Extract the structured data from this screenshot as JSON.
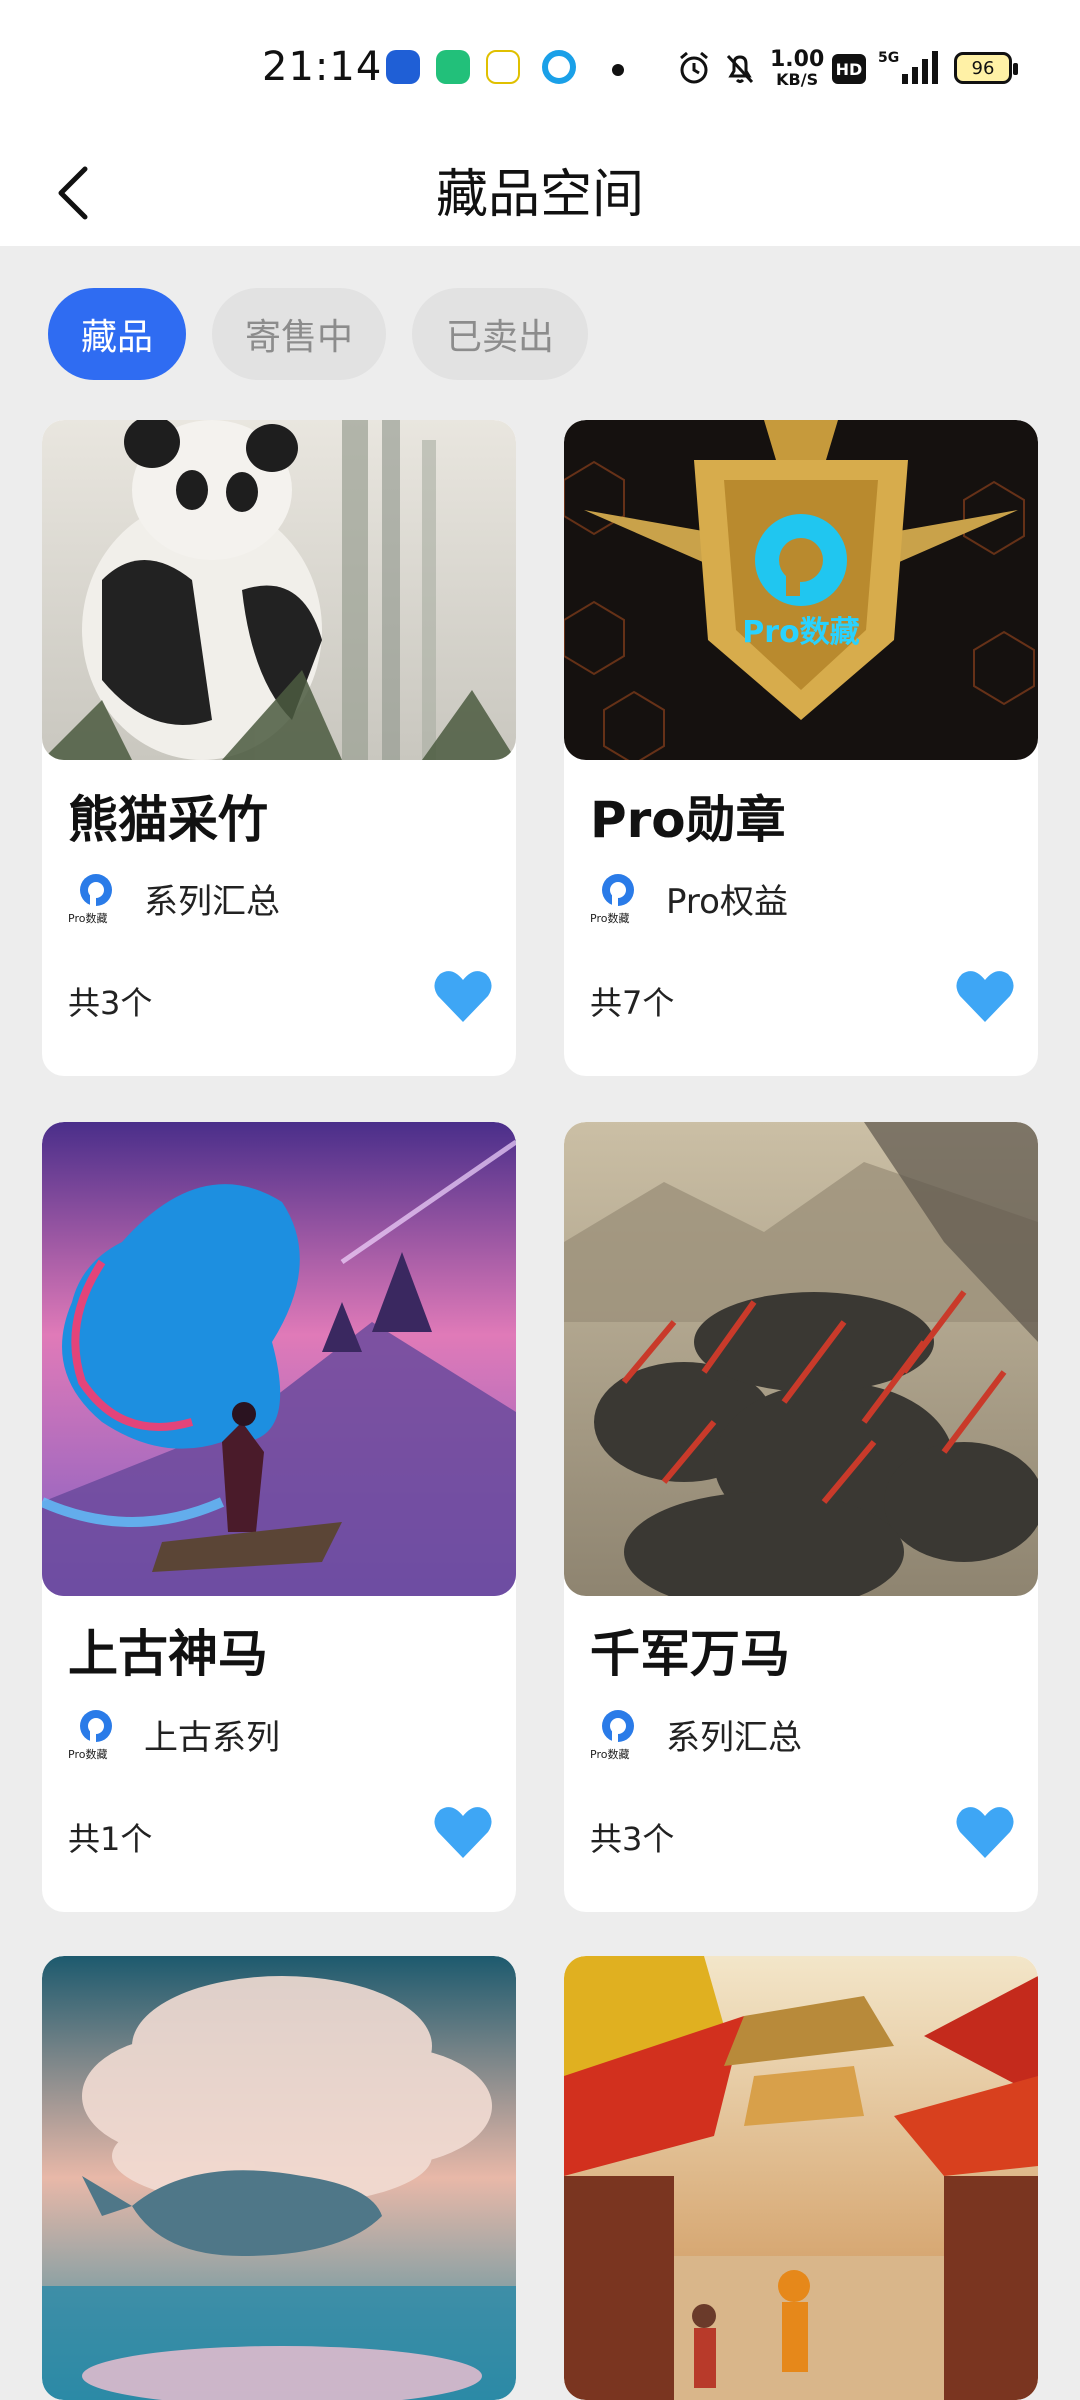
{
  "status": {
    "time": "21:14",
    "speed_value": "1.00",
    "speed_unit": "KB/S",
    "network": "5G",
    "battery": "96",
    "hd": "HD"
  },
  "header": {
    "title": "藏品空间"
  },
  "tabs": [
    {
      "label": "藏品",
      "active": true
    },
    {
      "label": "寄售中",
      "active": false
    },
    {
      "label": "已卖出",
      "active": false
    }
  ],
  "cards": [
    {
      "title": "熊猫采竹",
      "series": "系列汇总",
      "count": "共3个",
      "logo_text": "Pro数藏"
    },
    {
      "title": "Pro勋章",
      "series": "Pro权益",
      "count": "共7个",
      "logo_text": "Pro数藏",
      "image_text": "Pro数藏"
    },
    {
      "title": "上古神马",
      "series": "上古系列",
      "count": "共1个",
      "logo_text": "Pro数藏"
    },
    {
      "title": "千军万马",
      "series": "系列汇总",
      "count": "共3个",
      "logo_text": "Pro数藏"
    },
    {
      "title": "",
      "series": "",
      "count": ""
    },
    {
      "title": "",
      "series": "",
      "count": ""
    }
  ],
  "colors": {
    "accent": "#2f6cf2",
    "heart": "#3ea6f5",
    "page_bg": "#ededed"
  }
}
